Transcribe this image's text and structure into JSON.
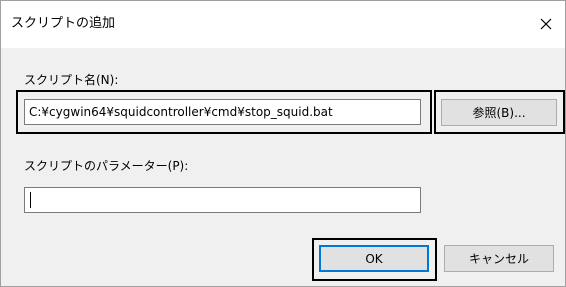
{
  "dialog": {
    "title": "スクリプトの追加",
    "close_icon": "close-icon"
  },
  "script_name": {
    "label": "スクリプト名(N):",
    "value": "C:¥cygwin64¥squidcontroller¥cmd¥stop_squid.bat",
    "browse_label": "参照(B)..."
  },
  "script_params": {
    "label": "スクリプトのパラメーター(P):",
    "value": ""
  },
  "buttons": {
    "ok_label": "OK",
    "cancel_label": "キャンセル"
  },
  "colors": {
    "dialog_background": "#f0f0f0",
    "titlebar_background": "#ffffff",
    "button_face": "#e1e1e1",
    "default_button_accent": "#0078d7",
    "highlight_frame": "#000000"
  }
}
